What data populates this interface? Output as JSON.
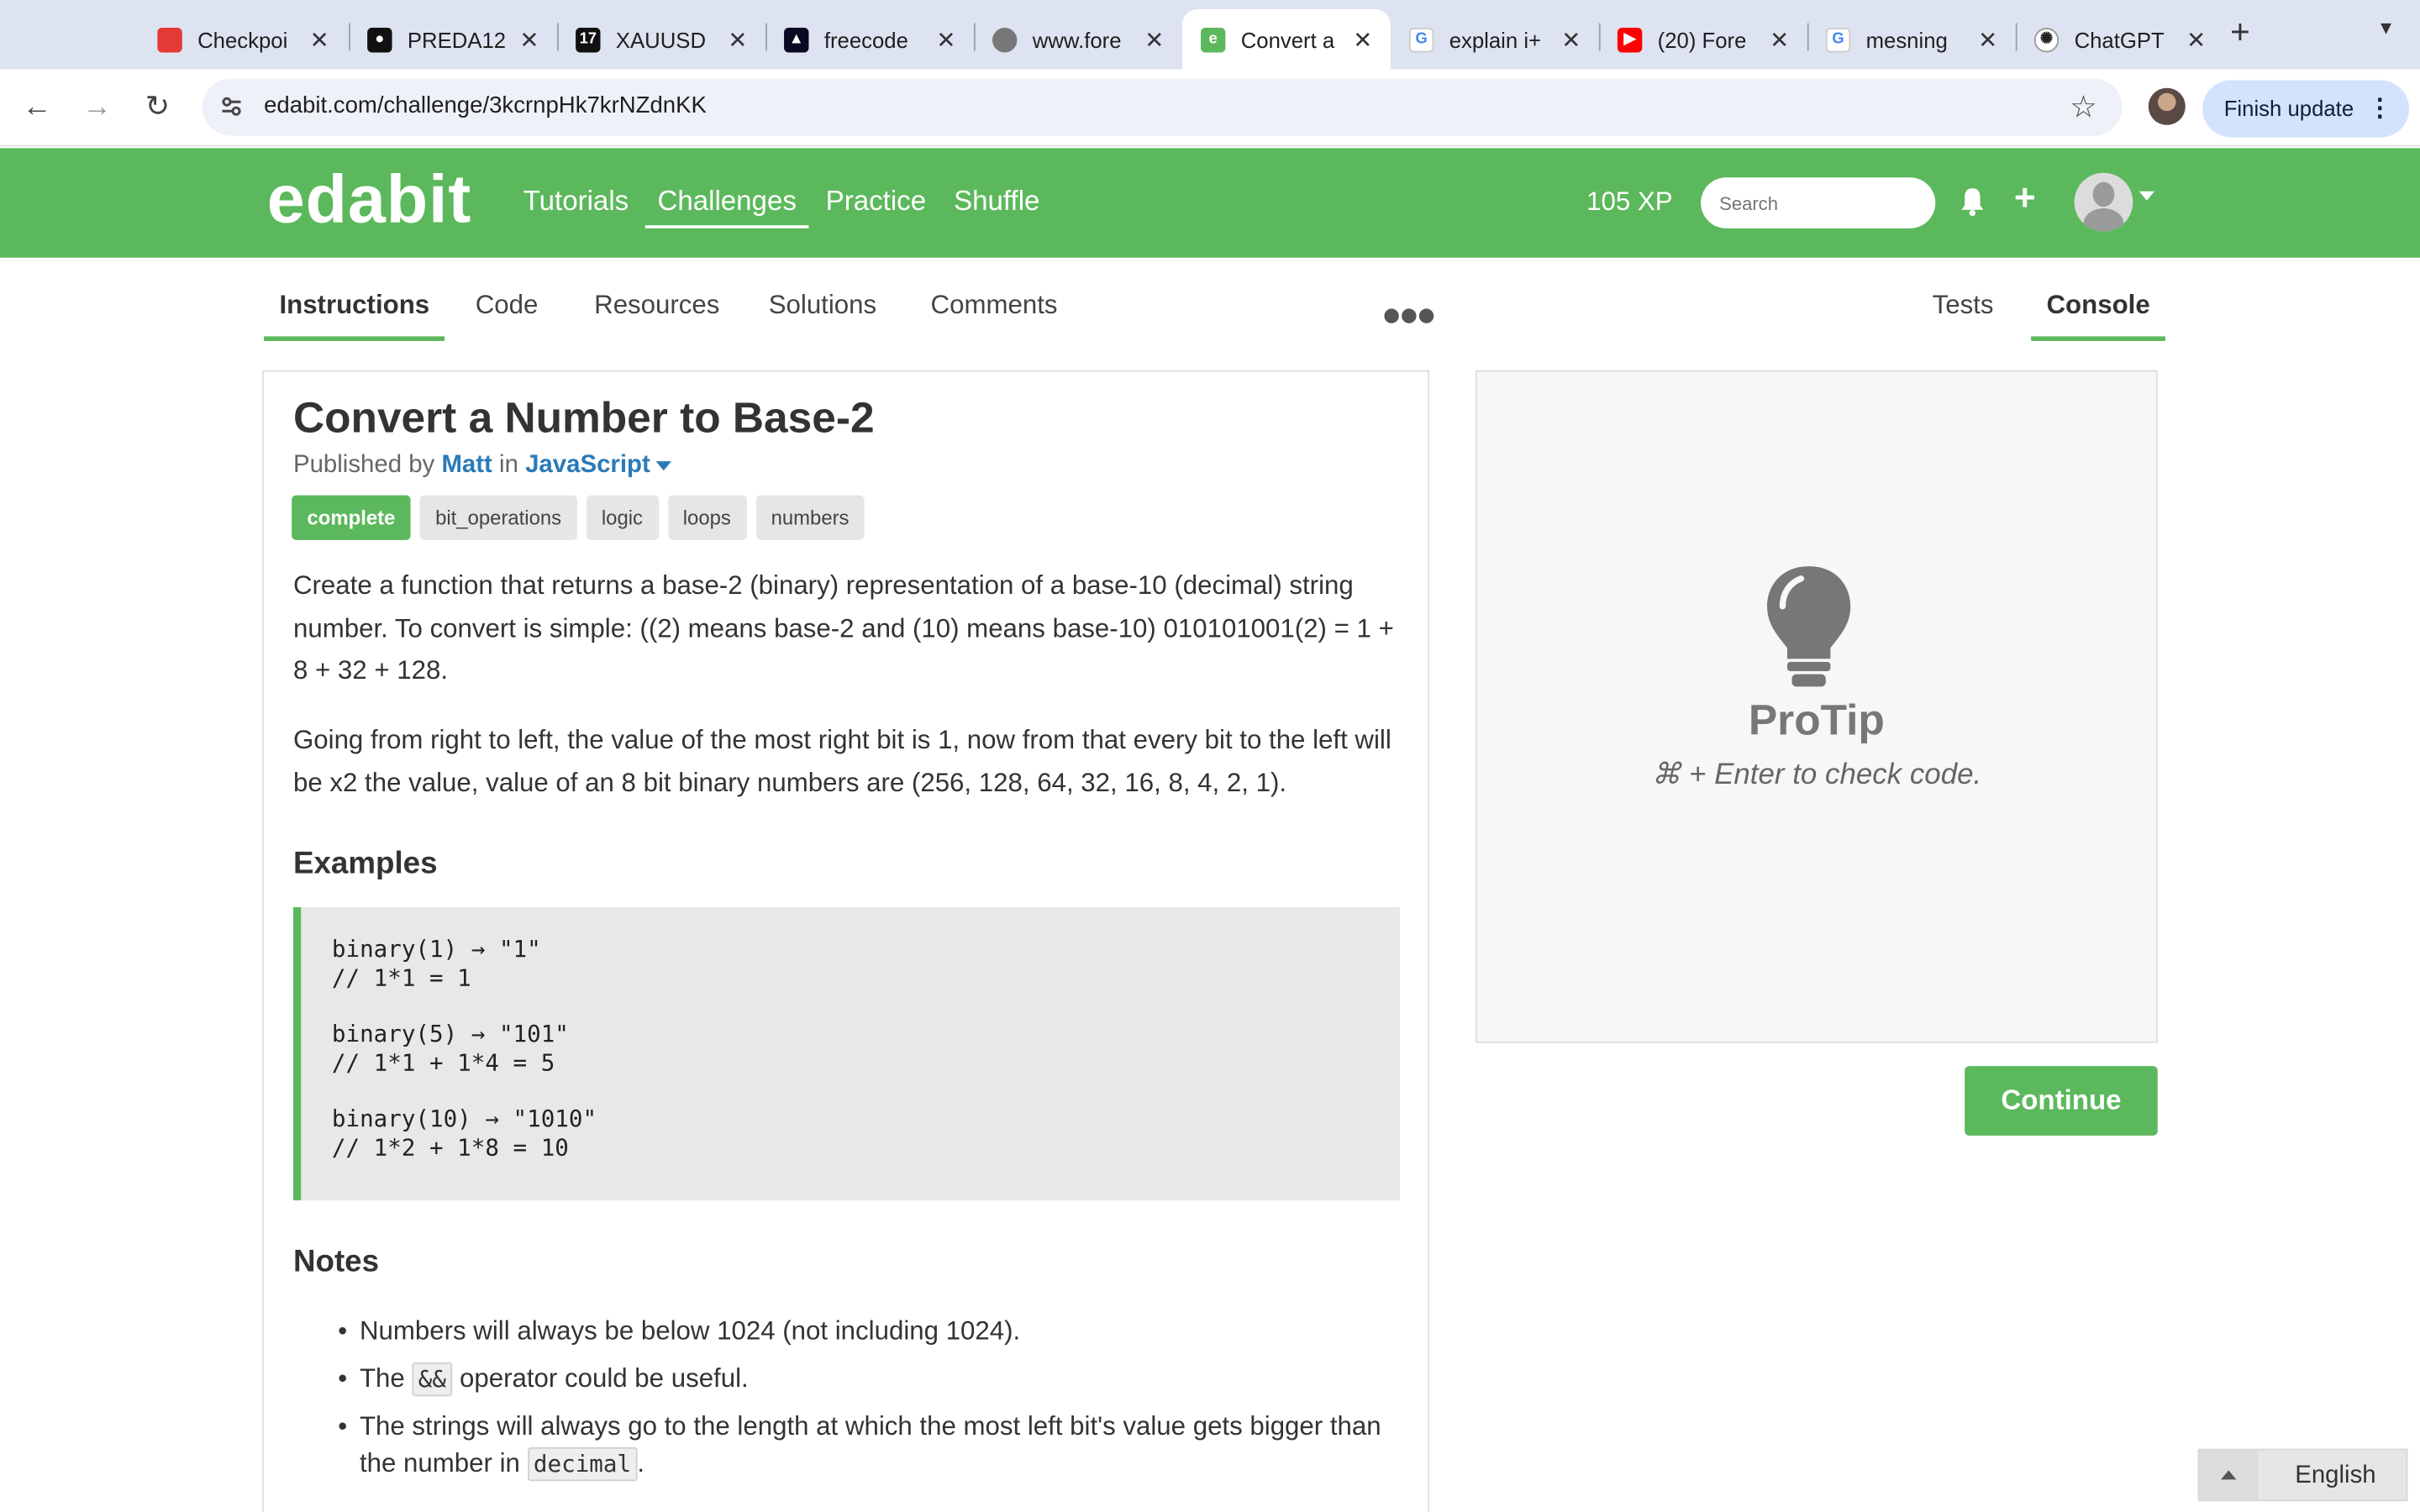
{
  "browser": {
    "tabs": [
      {
        "title": "Checkpoi",
        "icon": "checkpoint-icon",
        "color": "#e53935"
      },
      {
        "title": "PREDA12",
        "icon": "github-icon",
        "color": "#111111"
      },
      {
        "title": "XAUUSD",
        "icon": "tradingview-icon",
        "color": "#111111"
      },
      {
        "title": "freecode",
        "icon": "freecodecamp-icon",
        "color": "#0a0a23"
      },
      {
        "title": "www.fore",
        "icon": "globe-icon",
        "color": "#666666"
      },
      {
        "title": "Convert a",
        "icon": "edabit-icon",
        "color": "#5cb85c"
      },
      {
        "title": "explain i+",
        "icon": "google-icon",
        "color": "#4285f4"
      },
      {
        "title": "(20) Fore",
        "icon": "youtube-icon",
        "color": "#ff0000"
      },
      {
        "title": "mesning",
        "icon": "google-icon",
        "color": "#4285f4"
      },
      {
        "title": "ChatGPT",
        "icon": "chatgpt-icon",
        "color": "#222222"
      }
    ],
    "url": "edabit.com/challenge/3kcrnpHk7krNZdnKK",
    "finish_update": "Finish update"
  },
  "site": {
    "logo": "edabit",
    "nav": [
      "Tutorials",
      "Challenges",
      "Practice",
      "Shuffle"
    ],
    "active_nav": "Challenges",
    "xp": "105 XP",
    "search_placeholder": "Search",
    "brand_color": "#5cb85c"
  },
  "subtabs": {
    "left": [
      "Instructions",
      "Code",
      "Resources",
      "Solutions",
      "Comments"
    ],
    "right": [
      "Tests",
      "Console"
    ],
    "active_left": "Instructions",
    "active_right": "Console"
  },
  "challenge": {
    "title": "Convert a Number to Base-2",
    "published_by": "Published by",
    "author": "Matt",
    "in_word": "in",
    "language": "JavaScript",
    "tags": [
      "complete",
      "bit_operations",
      "logic",
      "loops",
      "numbers"
    ],
    "paragraph1": "Create a function that returns a base-2 (binary) representation of a base-10 (decimal) string number. To convert is simple: ((2) means base-2 and (10) means base-10) 010101001(2) = 1 + 8 + 32 + 128.",
    "paragraph2": "Going from right to left, the value of the most right bit is 1, now from that every bit to the left will be x2 the value, value of an 8 bit binary numbers are (256, 128, 64, 32, 16, 8, 4, 2, 1).",
    "examples_heading": "Examples",
    "examples": [
      {
        "call": "binary(1) → \"1\"",
        "comment": "// 1*1 = 1"
      },
      {
        "call": "binary(5) → \"101\"",
        "comment": "// 1*1 + 1*4 = 5"
      },
      {
        "call": "binary(10) → \"1010\"",
        "comment": "// 1*2 + 1*8 = 10"
      }
    ],
    "notes_heading": "Notes",
    "notes": {
      "n1": "Numbers will always be below 1024 (not including 1024).",
      "n2_pre": "The ",
      "n2_code": "&&",
      "n2_post": " operator could be useful.",
      "n3_pre": "The strings will always go to the length at which the most left bit's value gets bigger than the number in ",
      "n3_code": "decimal",
      "n3_post": "."
    }
  },
  "protip": {
    "title": "ProTip",
    "text": "⌘ + Enter to check code."
  },
  "continue_label": "Continue",
  "language_switcher": "English"
}
